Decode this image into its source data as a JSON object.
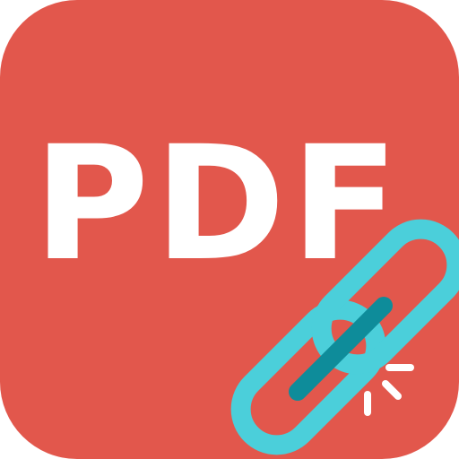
{
  "icon": {
    "label": "PDF",
    "background_color": "#E2574C",
    "text_color": "#FFFFFF",
    "link_icon": "chain-link-icon",
    "link_outer_color": "#4BCFDA",
    "link_inner_color": "#0E8C9A",
    "spark_color": "#FFFFFF"
  }
}
